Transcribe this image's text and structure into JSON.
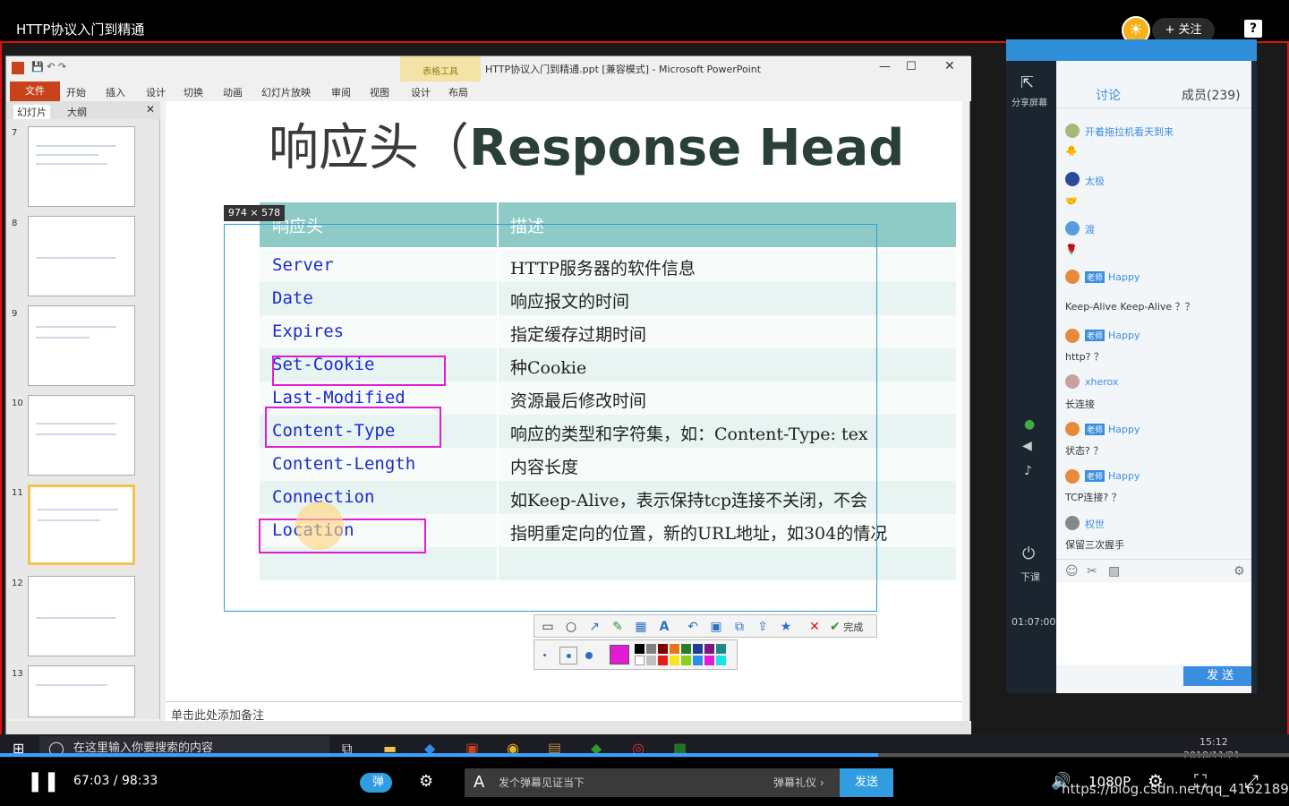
{
  "topbar": {
    "title": "HTTP协议入门到精通",
    "follow_label": "+ 关注",
    "help": "?"
  },
  "ppt": {
    "window_title": "HTTP协议入门到精通.ppt [兼容模式] - Microsoft PowerPoint",
    "table_tools": "表格工具",
    "tabs": [
      "文件",
      "开始",
      "插入",
      "设计",
      "切换",
      "动画",
      "幻灯片放映",
      "审阅",
      "视图",
      "设计",
      "布局"
    ],
    "panel_tabs": [
      "幻灯片",
      "大纲"
    ],
    "thumb_numbers": [
      "7",
      "8",
      "9",
      "10",
      "11",
      "12",
      "13"
    ],
    "notes_placeholder": "单击此处添加备注",
    "slide": {
      "title_cn": "响应头（",
      "title_en": "Response Head",
      "header": [
        "响应头",
        "描述"
      ],
      "rows": [
        {
          "name": "Server",
          "desc": "HTTP服务器的软件信息"
        },
        {
          "name": "Date",
          "desc": "响应报文的时间"
        },
        {
          "name": "Expires",
          "desc": "指定缓存过期时间"
        },
        {
          "name": "Set-Cookie",
          "desc": "种Cookie"
        },
        {
          "name": "Last-Modified",
          "desc": "资源最后修改时间"
        },
        {
          "name": "Content-Type",
          "desc": "响应的类型和字符集，如：Content-Type: tex"
        },
        {
          "name": "Content-Length",
          "desc": "内容长度"
        },
        {
          "name": "Connection",
          "desc": "如Keep-Alive，表示保持tcp连接不关闭，不会"
        },
        {
          "name": "Location",
          "desc": "指明重定向的位置，新的URL地址，如304的情况"
        }
      ]
    }
  },
  "capture": {
    "size_label": "974 × 578",
    "done_label": "完成"
  },
  "chat": {
    "share_label": "分享屏幕",
    "tab_discuss": "讨论",
    "tab_members": "成员(239)",
    "time_label": "01:07:00",
    "class_end": "下课",
    "send_label": "发 送",
    "messages": [
      {
        "name": "开着拖拉机看天到来",
        "text": "",
        "teacher": false
      },
      {
        "name": "太极",
        "text": "",
        "teacher": false
      },
      {
        "name": "渡",
        "text": "",
        "teacher": false
      },
      {
        "name": "Happy",
        "text": "Keep-Alive  Keep-Alive ？？",
        "teacher": true
      },
      {
        "name": "Happy",
        "text": "http? ？",
        "teacher": true
      },
      {
        "name": "xherox",
        "text": "长连接",
        "teacher": false
      },
      {
        "name": "Happy",
        "text": "状态? ？",
        "teacher": true
      },
      {
        "name": "Happy",
        "text": "TCP连接? ？",
        "teacher": true
      },
      {
        "name": "权世",
        "text": "保留三次握手",
        "teacher": false
      }
    ],
    "teacher_badge": "老师"
  },
  "taskbar": {
    "search_placeholder": "在这里输入你要搜索的内容",
    "clock_time": "15:12",
    "clock_date": "2018/11/21"
  },
  "player": {
    "time": "67:03 / 98:33",
    "danmu_toggle": "弹",
    "danmu_placeholder": "发个弹幕见证当下",
    "danmu_gift": "弹幕礼仪 ›",
    "danmu_send": "发送",
    "quality": "1080P",
    "watermark": "https://blog.csdn.net/qq_41621890",
    "progress_fraction": 0.6815
  }
}
